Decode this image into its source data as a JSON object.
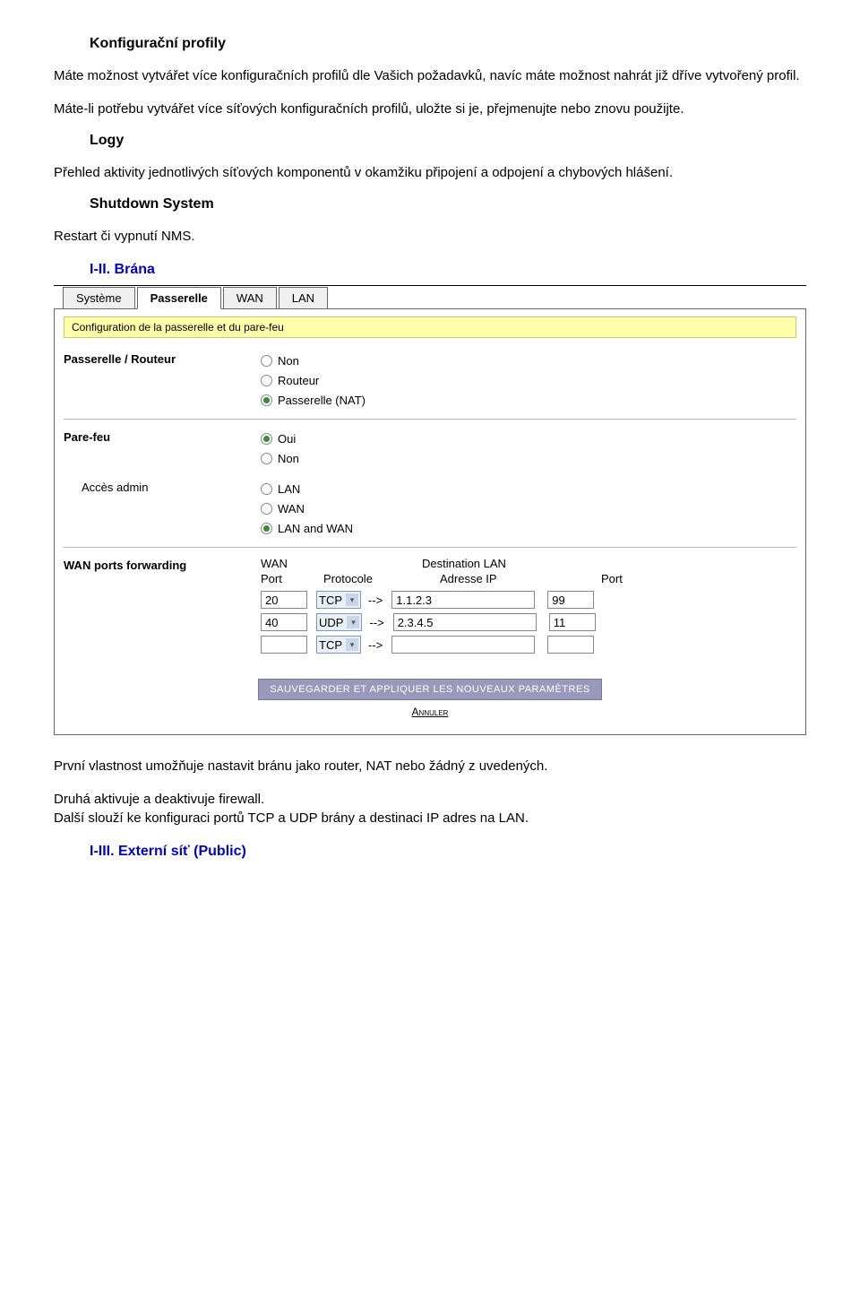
{
  "doc": {
    "h1": "Konfigurační profily",
    "p1": "Máte možnost vytvářet více konfiguračních profilů dle Vašich požadavků, navíc máte možnost nahrát již dříve vytvořený profil.",
    "p2": "Máte-li potřebu vytvářet více síťových konfiguračních profilů, uložte si je, přejmenujte nebo znovu použijte.",
    "h2": "Logy",
    "p3": "Přehled aktivity jednotlivých síťových komponentů v okamžiku připojení a odpojení a chybových hlášení.",
    "h3": "Shutdown System",
    "p4": "Restart či vypnutí NMS.",
    "h4": "I-II. Brána",
    "p5": "První vlastnost umožňuje nastavit bránu jako router, NAT nebo žádný z uvedených.",
    "p6": "Druhá aktivuje a deaktivuje firewall.",
    "p7": "Další slouží ke konfiguraci portů TCP a UDP brány a destinaci IP adres na LAN.",
    "h5": "I-III. Externí síť (Public)"
  },
  "panel": {
    "tabs": [
      "Système",
      "Passerelle",
      "WAN",
      "LAN"
    ],
    "active_tab": 1,
    "info": "Configuration de la passerelle et du pare-feu",
    "gateway": {
      "label": "Passerelle / Routeur",
      "options": [
        "Non",
        "Routeur",
        "Passerelle (NAT)"
      ],
      "selected": 2
    },
    "firewall": {
      "label": "Pare-feu",
      "options": [
        "Oui",
        "Non"
      ],
      "selected": 0
    },
    "admin": {
      "label": "Accès admin",
      "options": [
        "LAN",
        "WAN",
        "LAN and WAN"
      ],
      "selected": 2
    },
    "fwd": {
      "label": "WAN ports forwarding",
      "header_wan": "WAN",
      "header_dest": "Destination LAN",
      "sub_port": "Port",
      "sub_proto": "Protocole",
      "sub_ip": "Adresse IP",
      "sub_dport": "Port",
      "arrow": "-->",
      "rows": [
        {
          "port": "20",
          "proto": "TCP",
          "ip": "1.1.2.3",
          "dport": "99"
        },
        {
          "port": "40",
          "proto": "UDP",
          "ip": "2.3.4.5",
          "dport": "11"
        },
        {
          "port": "",
          "proto": "TCP",
          "ip": "",
          "dport": ""
        }
      ]
    },
    "save_btn": "SAUVEGARDER ET APPLIQUER LES NOUVEAUX PARAMÈTRES",
    "cancel": "Annuler"
  }
}
